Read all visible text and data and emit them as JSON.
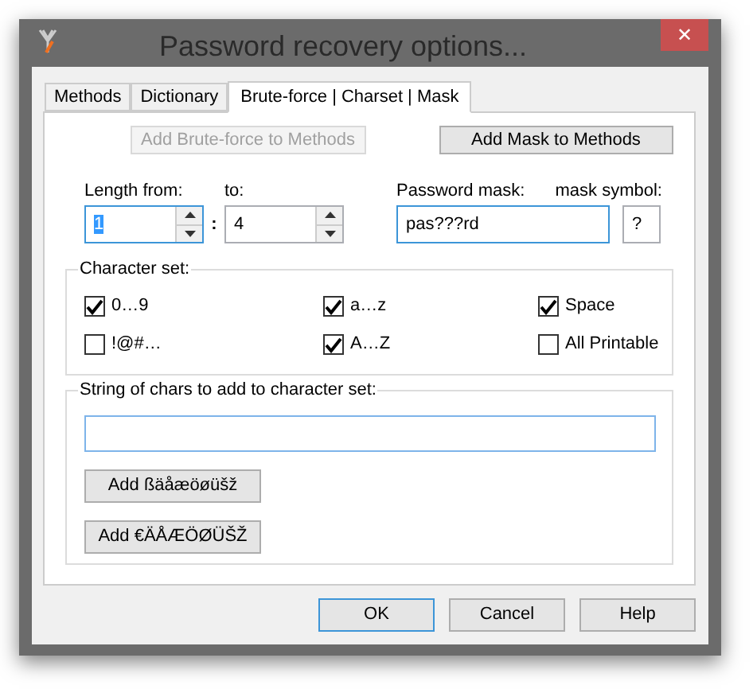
{
  "window": {
    "title": "Password recovery options...",
    "close": "✕"
  },
  "tabs": [
    {
      "label": "Methods",
      "selected": false
    },
    {
      "label": "Dictionary",
      "selected": false
    },
    {
      "label": "Brute-force | Charset | Mask",
      "selected": true
    }
  ],
  "top_buttons": [
    {
      "label": "Add Brute-force to Methods",
      "disabled": true
    },
    {
      "label": "Add Mask to Methods",
      "disabled": false
    }
  ],
  "length": {
    "from_label": "Length from:",
    "from_value": "1",
    "from_highlighted": true,
    "separator": ":",
    "to_label": "to:",
    "to_value": "4"
  },
  "mask": {
    "label": "Password mask:",
    "value": "pas???rd",
    "symbol_label": "mask symbol:",
    "symbol_value": "?"
  },
  "character_set": {
    "title": "Character set:",
    "items": [
      {
        "label": "0…9",
        "checked": true
      },
      {
        "label": "a…z",
        "checked": true
      },
      {
        "label": "Space",
        "checked": true
      },
      {
        "label": "!@#…",
        "checked": false
      },
      {
        "label": "A…Z",
        "checked": true
      },
      {
        "label": "All Printable",
        "checked": false
      }
    ]
  },
  "extra_chars": {
    "title": "String of chars to add to character set:",
    "buttons": [
      "Add ßäåæöøüšž",
      "Add €ÄÅÆÖØÜŠŽ"
    ]
  },
  "dialog_buttons": [
    {
      "label": "OK",
      "default": true
    },
    {
      "label": "Cancel",
      "default": false
    },
    {
      "label": "Help",
      "default": false
    }
  ]
}
